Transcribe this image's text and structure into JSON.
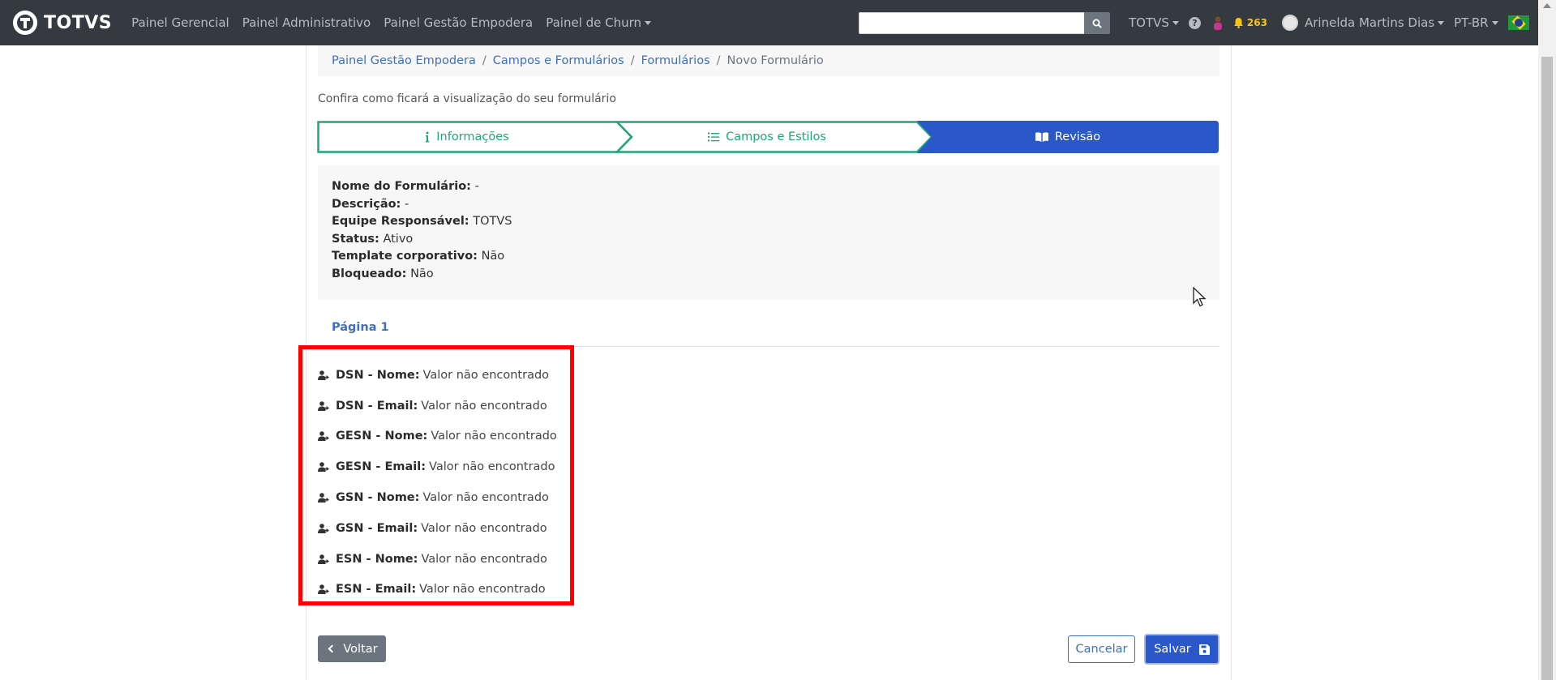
{
  "navbar": {
    "brand": "TOTVS",
    "links": [
      {
        "label": "Painel Gerencial"
      },
      {
        "label": "Painel Administrativo"
      },
      {
        "label": "Painel Gestão Empodera"
      },
      {
        "label": "Painel de Churn"
      }
    ],
    "search": {
      "value": "",
      "placeholder": ""
    },
    "org_menu": "TOTVS",
    "notifications_count": "263",
    "user_name": "Arinelda Martins Dias",
    "language": "PT-BR"
  },
  "breadcrumb": {
    "items": [
      "Painel Gestão Empodera",
      "Campos e Formulários",
      "Formulários"
    ],
    "current": "Novo Formulário"
  },
  "subtitle": "Confira como ficará a visualização do seu formulário",
  "stepper": {
    "steps": [
      {
        "label": "Informações",
        "icon": "info-icon",
        "state": "complete"
      },
      {
        "label": "Campos e Estilos",
        "icon": "list-icon",
        "state": "complete"
      },
      {
        "label": "Revisão",
        "icon": "book-open-icon",
        "state": "active"
      }
    ]
  },
  "info": [
    {
      "key": "Nome do Formulário:",
      "value": "-"
    },
    {
      "key": "Descrição:",
      "value": "-"
    },
    {
      "key": "Equipe Responsável:",
      "value": "TOTVS"
    },
    {
      "key": "Status:",
      "value": "Ativo"
    },
    {
      "key": "Template corporativo:",
      "value": "Não"
    },
    {
      "key": "Bloqueado:",
      "value": "Não"
    }
  ],
  "page_tab": "Página 1",
  "fields": [
    {
      "label": "DSN - Nome:",
      "value": "Valor não encontrado"
    },
    {
      "label": "DSN - Email:",
      "value": "Valor não encontrado"
    },
    {
      "label": "GESN - Nome:",
      "value": "Valor não encontrado"
    },
    {
      "label": "GESN - Email:",
      "value": "Valor não encontrado"
    },
    {
      "label": "GSN - Nome:",
      "value": "Valor não encontrado"
    },
    {
      "label": "GSN - Email:",
      "value": "Valor não encontrado"
    },
    {
      "label": "ESN - Nome:",
      "value": "Valor não encontrado"
    },
    {
      "label": "ESN - Email:",
      "value": "Valor não encontrado"
    }
  ],
  "buttons": {
    "back": "Voltar",
    "cancel": "Cancelar",
    "save": "Salvar"
  },
  "colors": {
    "navbar_bg": "#343a40",
    "step_complete": "#1fa67a",
    "step_active": "#2a58c9",
    "highlight": "#ff0000",
    "link": "#3f6fbf"
  }
}
